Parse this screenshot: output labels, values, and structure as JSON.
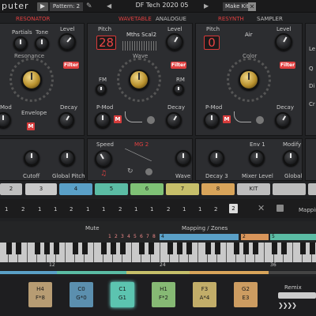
{
  "header": {
    "title_fragment": "puter",
    "pattern_label": "Pattern: 2",
    "preset_name": "DF Tech 2020 05",
    "make_kit_label": "Make Kit"
  },
  "tabs": {
    "resonator": "RESONATOR",
    "wavetable": "WAVETABLE",
    "analogue": "ANALOGUE",
    "resynth": "RESYNTH",
    "sampler": "SAMPLER"
  },
  "voice1": {
    "partials": "Partials",
    "tone": "Tone",
    "level": "Level",
    "resonance": "Resonance",
    "filter": "Filter",
    "envelope": "Envelope",
    "decay": "Decay",
    "mod": "Mod",
    "m": "M"
  },
  "voice2": {
    "pitch": "Pitch",
    "pitch_value": "28",
    "name": "Mths Scal2",
    "wave": "Wave",
    "level": "Level",
    "fm": "FM",
    "rm": "RM",
    "filter": "Filter",
    "pmod": "P-Mod",
    "decay": "Decay",
    "m": "M"
  },
  "voice3": {
    "pitch": "Pitch",
    "pitch_value": "0",
    "name": "Air",
    "color": "Color",
    "level": "Level",
    "filter": "Filter",
    "pmod": "P-Mod",
    "decay": "Decay",
    "m": "M"
  },
  "voice4": {
    "side_labels": [
      "Le",
      "Q",
      "Di",
      "Cr"
    ]
  },
  "mod": {
    "cutoff": "Cutoff",
    "global_pitch": "Global Pitch",
    "speed": "Speed",
    "mg2": "MG 2",
    "wave": "Wave",
    "decay3": "Decay 3",
    "env1": "Env 1",
    "modify": "Modify",
    "mixer_level": "Mixer Level",
    "global": "Global"
  },
  "track_tabs": [
    {
      "label": "2",
      "color": "#bfbfbf"
    },
    {
      "label": "3",
      "color": "#c9c9c9"
    },
    {
      "label": "4",
      "color": "#5aa0c7"
    },
    {
      "label": "5",
      "color": "#5bbca4"
    },
    {
      "label": "6",
      "color": "#7fc276"
    },
    {
      "label": "7",
      "color": "#c6bf6a"
    },
    {
      "label": "8",
      "color": "#d8a45a"
    },
    {
      "label": "KIT",
      "color": "#bdbdbd"
    }
  ],
  "sequence": {
    "steps": [
      "1",
      "2",
      "1",
      "1",
      "2",
      "1",
      "1",
      "2",
      "1",
      "1",
      "2",
      "1",
      "1",
      "2"
    ],
    "last_step": "2",
    "mapping_label": "Mappin"
  },
  "zones": {
    "mute": "Mute",
    "mapping": "Mapping / Zones",
    "mute_numbers": [
      "1",
      "2",
      "3",
      "4",
      "5",
      "6",
      "7",
      "8"
    ],
    "zone4": "4",
    "zone2": "2",
    "zone5": "5",
    "octave_24": "24",
    "octave_36": "36",
    "octave_12": "12"
  },
  "pads": [
    {
      "top": "H4",
      "bottom": "F*8",
      "color": "#b79c73"
    },
    {
      "top": "C0",
      "bottom": "G*0",
      "color": "#5b8fae"
    },
    {
      "top": "C1",
      "bottom": "G1",
      "color": "#5cc4b0"
    },
    {
      "top": "H1",
      "bottom": "F*2",
      "color": "#86b974"
    },
    {
      "top": "F3",
      "bottom": "A*4",
      "color": "#c2ad69"
    },
    {
      "top": "G2",
      "bottom": "E3",
      "color": "#cc9c61"
    }
  ],
  "remix": {
    "label": "Remix"
  },
  "colors": {
    "accent_red": "#e04040",
    "gold": "#d4b058"
  }
}
